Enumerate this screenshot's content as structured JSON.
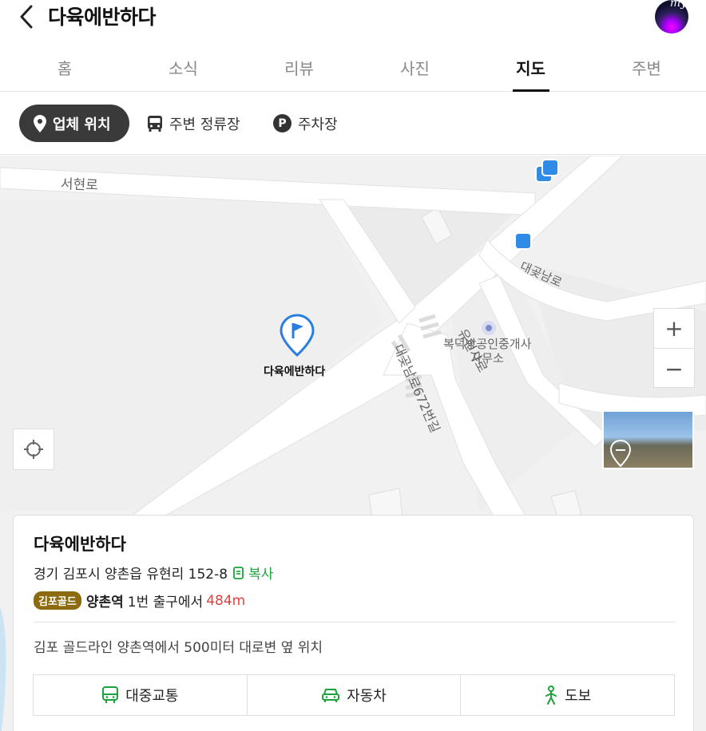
{
  "header": {
    "title": "다육에반하다",
    "avatar_text": "my"
  },
  "tabs": [
    {
      "label": "홈",
      "active": false
    },
    {
      "label": "소식",
      "active": false
    },
    {
      "label": "리뷰",
      "active": false
    },
    {
      "label": "사진",
      "active": false
    },
    {
      "label": "지도",
      "active": true
    },
    {
      "label": "주변",
      "active": false
    }
  ],
  "chips": {
    "business_location": "업체 위치",
    "nearby_stops": "주변 정류장",
    "parking": "주차장",
    "parking_icon_letter": "P"
  },
  "map": {
    "labels": {
      "seohyeon_ro": "서현로",
      "daekkot_nam_ro": "대곶남로",
      "yuhyeon_ro": "유현사로",
      "road_672": "대곶남로672번길",
      "office_line1": "복덕방공인중개사",
      "office_line2": "사무소"
    },
    "marker_label": "다육에반하다",
    "zoom_in": "+",
    "zoom_out": "−"
  },
  "card": {
    "title": "다육에반하다",
    "address": "경기 김포시 양촌읍 유현리 152-8",
    "copy_label": "복사",
    "line_badge": "김포골드",
    "station": "양촌역",
    "exit_text": "1번 출구에서",
    "distance": "484m",
    "description": "김포 골드라인 양촌역에서 500미터 대로변 옆 위치",
    "buttons": {
      "transit": "대중교통",
      "car": "자동차",
      "walk": "도보"
    }
  },
  "colors": {
    "accent_green": "#1aa33a",
    "distance_red": "#e0413a",
    "badge_gold": "#8b6a10",
    "chip_active": "#3a3a3a",
    "marker_blue": "#2a7de1"
  }
}
